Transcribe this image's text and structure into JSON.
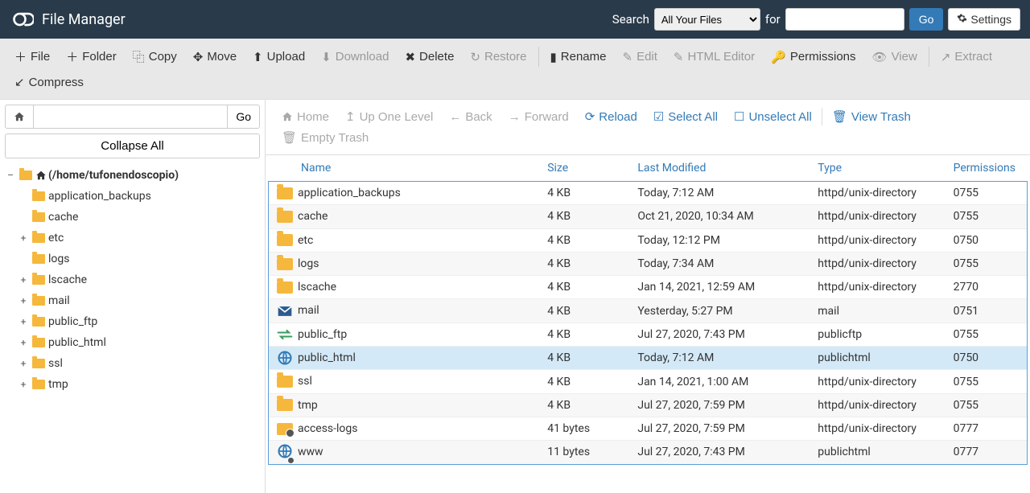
{
  "header": {
    "title": "File Manager",
    "search_label": "Search",
    "search_select": "All Your Files",
    "for_label": "for",
    "go_label": "Go",
    "settings_label": "Settings"
  },
  "toolbar": {
    "file": "File",
    "folder": "Folder",
    "copy": "Copy",
    "move": "Move",
    "upload": "Upload",
    "download": "Download",
    "delete": "Delete",
    "restore": "Restore",
    "rename": "Rename",
    "edit": "Edit",
    "html_editor": "HTML Editor",
    "permissions": "Permissions",
    "view": "View",
    "extract": "Extract",
    "compress": "Compress"
  },
  "sidebar": {
    "go_label": "Go",
    "collapse_all": "Collapse All",
    "root_label": "(/home/tufonendoscopio)",
    "tree": [
      {
        "label": "application_backups",
        "expandable": false
      },
      {
        "label": "cache",
        "expandable": false
      },
      {
        "label": "etc",
        "expandable": true
      },
      {
        "label": "logs",
        "expandable": false
      },
      {
        "label": "lscache",
        "expandable": true
      },
      {
        "label": "mail",
        "expandable": true
      },
      {
        "label": "public_ftp",
        "expandable": true
      },
      {
        "label": "public_html",
        "expandable": true
      },
      {
        "label": "ssl",
        "expandable": true
      },
      {
        "label": "tmp",
        "expandable": true
      }
    ]
  },
  "actionbar": {
    "home": "Home",
    "up_one": "Up One Level",
    "back": "Back",
    "forward": "Forward",
    "reload": "Reload",
    "select_all": "Select All",
    "unselect_all": "Unselect All",
    "view_trash": "View Trash",
    "empty_trash": "Empty Trash"
  },
  "table": {
    "headers": {
      "name": "Name",
      "size": "Size",
      "modified": "Last Modified",
      "type": "Type",
      "perms": "Permissions"
    },
    "rows": [
      {
        "icon": "folder",
        "name": "application_backups",
        "size": "4 KB",
        "modified": "Today, 7:12 AM",
        "type": "httpd/unix-directory",
        "perms": "0755",
        "selected": false
      },
      {
        "icon": "folder",
        "name": "cache",
        "size": "4 KB",
        "modified": "Oct 21, 2020, 10:34 AM",
        "type": "httpd/unix-directory",
        "perms": "0755",
        "selected": false
      },
      {
        "icon": "folder",
        "name": "etc",
        "size": "4 KB",
        "modified": "Today, 12:12 PM",
        "type": "httpd/unix-directory",
        "perms": "0750",
        "selected": false
      },
      {
        "icon": "folder",
        "name": "logs",
        "size": "4 KB",
        "modified": "Today, 7:34 AM",
        "type": "httpd/unix-directory",
        "perms": "0755",
        "selected": false
      },
      {
        "icon": "folder",
        "name": "lscache",
        "size": "4 KB",
        "modified": "Jan 14, 2021, 12:59 AM",
        "type": "httpd/unix-directory",
        "perms": "2770",
        "selected": false
      },
      {
        "icon": "mail",
        "name": "mail",
        "size": "4 KB",
        "modified": "Yesterday, 5:27 PM",
        "type": "mail",
        "perms": "0751",
        "selected": false
      },
      {
        "icon": "ftp",
        "name": "public_ftp",
        "size": "4 KB",
        "modified": "Jul 27, 2020, 7:43 PM",
        "type": "publicftp",
        "perms": "0755",
        "selected": false
      },
      {
        "icon": "globe",
        "name": "public_html",
        "size": "4 KB",
        "modified": "Today, 7:12 AM",
        "type": "publichtml",
        "perms": "0750",
        "selected": true
      },
      {
        "icon": "folder",
        "name": "ssl",
        "size": "4 KB",
        "modified": "Jan 14, 2021, 1:00 AM",
        "type": "httpd/unix-directory",
        "perms": "0755",
        "selected": false
      },
      {
        "icon": "folder",
        "name": "tmp",
        "size": "4 KB",
        "modified": "Jul 27, 2020, 7:59 PM",
        "type": "httpd/unix-directory",
        "perms": "0755",
        "selected": false
      },
      {
        "icon": "folder-link",
        "name": "access-logs",
        "size": "41 bytes",
        "modified": "Jul 27, 2020, 7:59 PM",
        "type": "httpd/unix-directory",
        "perms": "0777",
        "selected": false
      },
      {
        "icon": "globe-link",
        "name": "www",
        "size": "11 bytes",
        "modified": "Jul 27, 2020, 7:43 PM",
        "type": "publichtml",
        "perms": "0777",
        "selected": false
      }
    ]
  }
}
